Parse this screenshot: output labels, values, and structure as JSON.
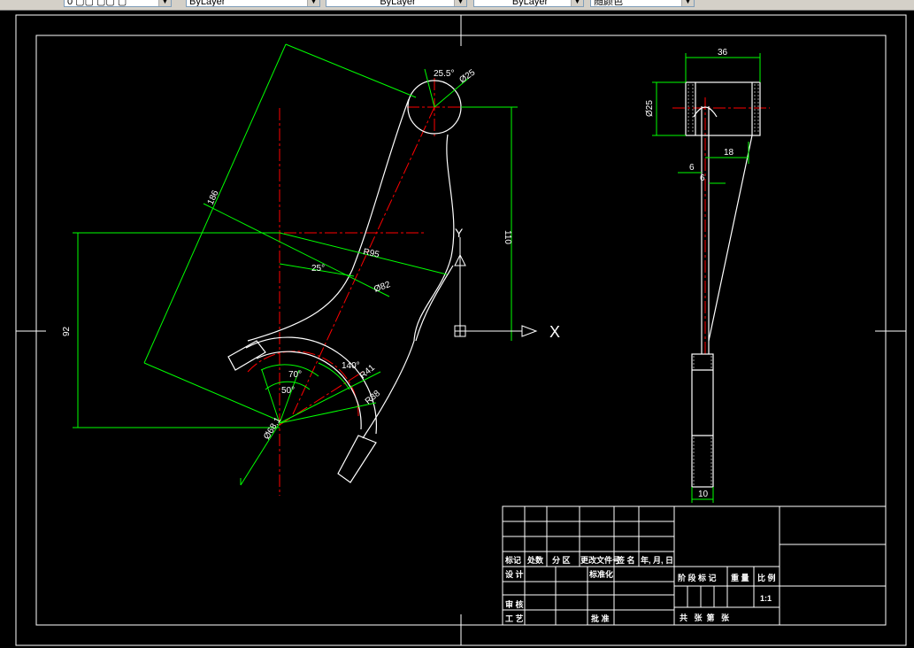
{
  "toolbar": {
    "layer_value": "0 ▢▢ ▢▢ ▢",
    "color_value": "ByLayer",
    "linetype_value": "ByLayer",
    "lineweight_value": "ByLayer",
    "plotstyle_value": "随颜色"
  },
  "drawing": {
    "left_view": {
      "dims": {
        "angle_top": "25.5°",
        "dia_top": "Ø25",
        "len_186": "186",
        "r95": "R95",
        "ang25": "25°",
        "dia82": "Ø82",
        "h110": "110",
        "v92": "92",
        "ang70": "70°",
        "ang50": "50°",
        "ang140": "140°",
        "r41": "R41",
        "r38": "R38",
        "dia_bottom": "Ø68.1"
      },
      "ucs": {
        "y_label": "Y",
        "x_label": "X"
      }
    },
    "right_view": {
      "dims": {
        "w36": "36",
        "dia25": "Ø25",
        "w18": "18",
        "w6a": "6",
        "w6b": "6",
        "w10": "10"
      }
    },
    "title_block": {
      "headers": [
        "标记",
        "处数",
        "分 区",
        "更改文件号",
        "签 名",
        "年, 月, 日"
      ],
      "design": "设 计",
      "standardize": "标准化",
      "review": "审 核",
      "process": "工 艺",
      "approve": "批 准",
      "stage_mark": "阶 段 标 记",
      "weight": "重 量",
      "scale": "比 例",
      "scale_value": "1:1",
      "sheet_total": "共   张  第   张"
    }
  },
  "colors": {
    "background": "#000000",
    "outline": "#ffffff",
    "dimension": "#00ff00",
    "centerline": "#ff0000"
  }
}
